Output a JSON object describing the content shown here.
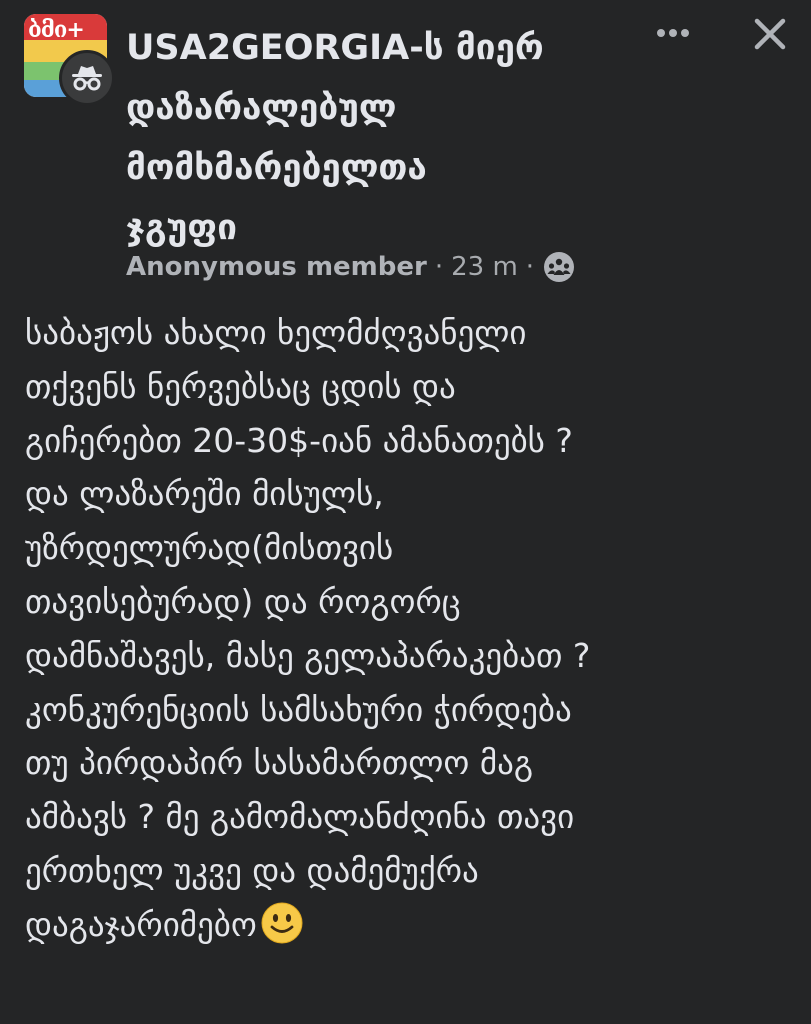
{
  "header": {
    "group_name_lines": [
      "USA2GEORGIA-ს მიერ",
      "დაზარალებულ",
      "მომხმარებელთა",
      "ჯგუფი"
    ],
    "avatar_glyphs": "ბმი+",
    "author": "Anonymous member",
    "time": "23 m",
    "dot1": "·",
    "dot2": "·",
    "more_icon": "more-horizontal-icon",
    "close_icon": "close-icon",
    "privacy_icon": "group-members-icon",
    "anon_icon": "incognito-icon"
  },
  "post": {
    "lines": [
      "საბაჟოს ახალი ხელმძღვანელი",
      "თქვენს ნერვებსაც ცდის და",
      "გიჩერებთ 20-30$-იან ამანათებს ?",
      "და ლაზარეში მისულს,",
      "უზრდელურად(მისთვის",
      "თავისებურად) და როგორც",
      "დამნაშავეს, მასე გელაპარაკებათ ?",
      "კონკურენციის სამსახური ჭირდება",
      "თუ პირდაპირ სასამართლო მაგ",
      "ამბავს ? მე გამომალანძღინა თავი",
      "ერთხელ უკვე და დამემუქრა",
      "დაგაჯარიმებო"
    ],
    "emoji": "slightly-smiling-face-icon"
  },
  "colors": {
    "background": "#242526",
    "primary_text": "#e4e6eb",
    "secondary_text": "#b0b3b8",
    "emoji_yellow": "#f7c948"
  }
}
